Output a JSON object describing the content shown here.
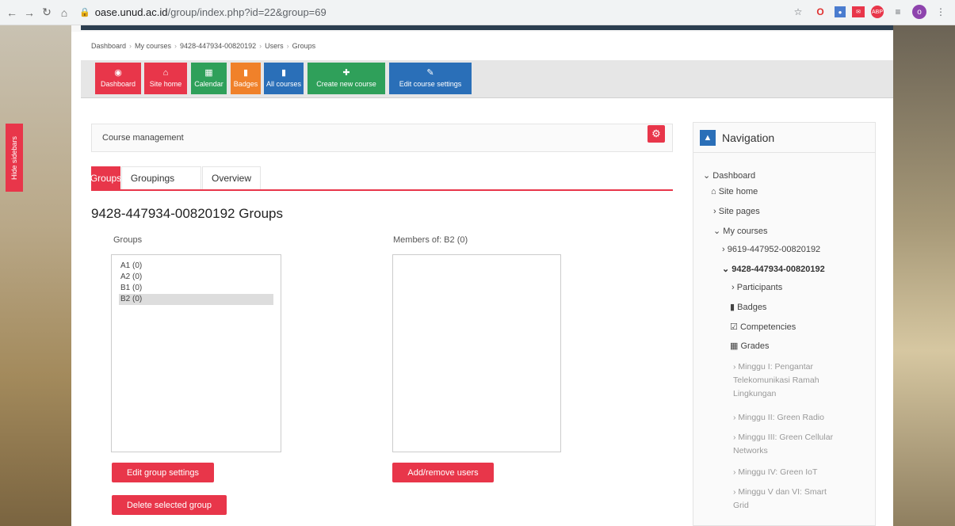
{
  "browser": {
    "url_domain": "oase.unud.ac.id",
    "url_path": "/group/index.php?id=22&group=69",
    "nav_icons": [
      "back-arrow-icon",
      "forward-arrow-icon",
      "reload-icon",
      "home-icon"
    ],
    "extension_icons": [
      "star-icon",
      "opera-icon",
      "extension-icon",
      "mail-extension-icon",
      "adblock-icon",
      "queue-icon",
      "profile-icon",
      "kebab-menu-icon"
    ]
  },
  "sidebar_toggle": "Hide sidebars",
  "breadcrumb": [
    "Dashboard",
    "My courses",
    "9428-447934-00820192",
    "Users",
    "Groups"
  ],
  "toolbar": {
    "buttons": [
      {
        "label": "Dashboard",
        "icon": "dashboard-icon",
        "color": "#e8364a"
      },
      {
        "label": "Site home",
        "icon": "home-icon",
        "color": "#e8364a"
      },
      {
        "label": "Calendar",
        "icon": "calendar-icon",
        "color": "#2fa05a"
      },
      {
        "label": "Badges",
        "icon": "bookmark-icon",
        "color": "#f0812a"
      },
      {
        "label": "All courses",
        "icon": "book-icon",
        "color": "#2a6fb8"
      },
      {
        "label": "Create new course",
        "icon": "plus-icon",
        "color": "#2fa05a"
      },
      {
        "label": "Edit course settings",
        "icon": "edit-icon",
        "color": "#2a6fb8"
      }
    ]
  },
  "course_management": "Course management",
  "tabs": [
    "Groups",
    "Groupings",
    "Overview"
  ],
  "page_title": "9428-447934-00820192 Groups",
  "groups": {
    "label": "Groups",
    "options": [
      "A1 (0)",
      "A2 (0)",
      "B1 (0)",
      "B2 (0)"
    ],
    "selected": "B2 (0)",
    "edit_button": "Edit group settings",
    "delete_button": "Delete selected group"
  },
  "members": {
    "label": "Members of: B2 (0)",
    "add_remove_button": "Add/remove users"
  },
  "navigation": {
    "title": "Navigation",
    "items": {
      "dashboard": "Dashboard",
      "site_home": "Site home",
      "site_pages": "Site pages",
      "my_courses": "My courses",
      "course1": "9619-447952-00820192",
      "course2": "9428-447934-00820192",
      "participants": "Participants",
      "badges": "Badges",
      "competencies": "Competencies",
      "grades": "Grades",
      "week1_l1": "Minggu I: Pengantar",
      "week1_l2": "Telekomunikasi Ramah",
      "week1_l3": "Lingkungan",
      "week2": "Minggu II: Green Radio",
      "week3_l1": "Minggu III: Green Cellular",
      "week3_l2": "Networks",
      "week4": "Minggu IV: Green IoT",
      "week5_l1": "Minggu V dan VI: Smart",
      "week5_l2": "Grid"
    }
  }
}
